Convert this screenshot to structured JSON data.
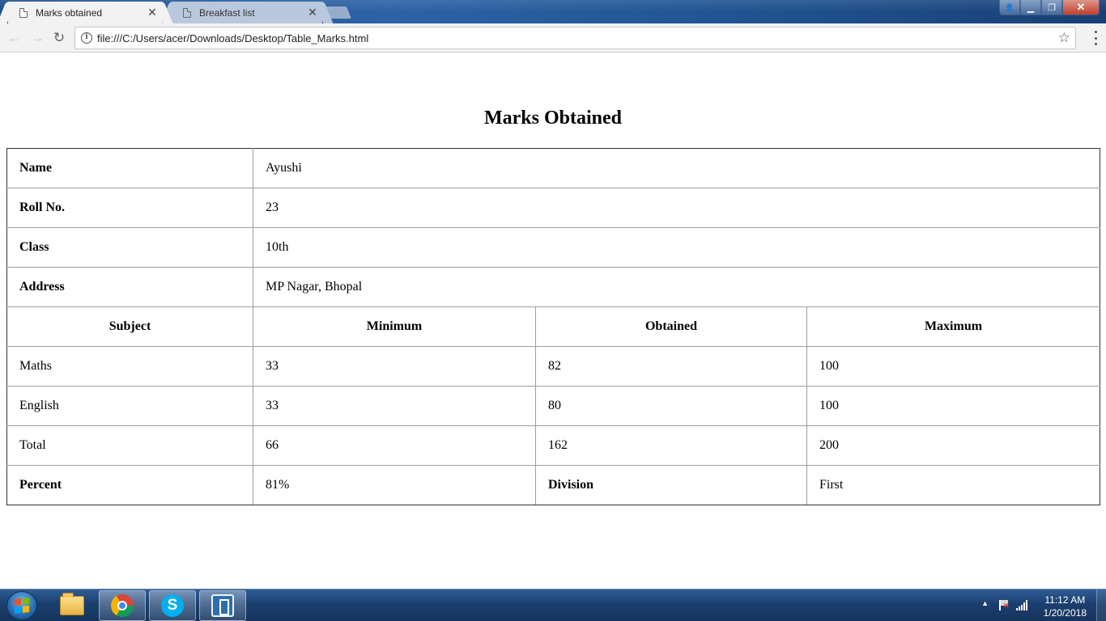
{
  "browser": {
    "tabs": [
      {
        "title": "Marks obtained",
        "close": "✕"
      },
      {
        "title": "Breakfast list",
        "close": "✕"
      }
    ],
    "url": "file:///C:/Users/acer/Downloads/Desktop/Table_Marks.html",
    "nav": {
      "back": "←",
      "forward": "→",
      "reload": "↻",
      "star": "☆"
    },
    "window_controls": {
      "minimize": "▁",
      "restore": "❐",
      "close": "✕",
      "user": "👤"
    }
  },
  "page": {
    "title": "Marks Obtained",
    "info_rows": [
      {
        "label": "Name",
        "value": "Ayushi"
      },
      {
        "label": "Roll No.",
        "value": "23"
      },
      {
        "label": "Class",
        "value": "10th"
      },
      {
        "label": "Address",
        "value": "MP Nagar, Bhopal"
      }
    ],
    "headers": [
      "Subject",
      "Minimum",
      "Obtained",
      "Maximum"
    ],
    "subject_rows": [
      [
        "Maths",
        "33",
        "82",
        "100"
      ],
      [
        "English",
        "33",
        "80",
        "100"
      ],
      [
        "Total",
        "66",
        "162",
        "200"
      ]
    ],
    "summary": {
      "percent_label": "Percent",
      "percent_value": "81%",
      "division_label": "Division",
      "division_value": "First"
    }
  },
  "taskbar": {
    "apps": [
      "file-explorer-icon",
      "chrome-icon",
      "skype-icon",
      "app-icon"
    ],
    "skype_glyph": "S",
    "tray_up": "▲",
    "time": "11:12 AM",
    "date": "1/20/2018"
  }
}
